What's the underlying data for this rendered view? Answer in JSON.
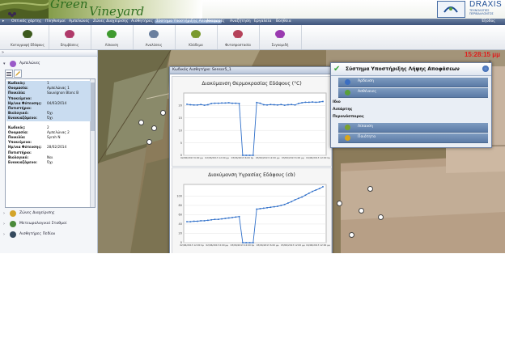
{
  "header": {
    "logo_line1": "Green",
    "logo_line2": "Vineyard",
    "company_name": "DRAXIS",
    "company_sub1": "ΤΕΧΝΟΛΟΓΙΕΣ",
    "company_sub2": "ΠΕΡΙΒΑΛΛΟΝΤΟΣ"
  },
  "menu": {
    "items": [
      "Οπτικός χάρτης",
      "Πληθυσμοί",
      "Αμπελώνες",
      "Ζώνες Διαχείρισης",
      "Αισθητήρες",
      "Σύστημα Υποστήριξης Αποφάσεων",
      "Αναφορές",
      "Αναζήτηση",
      "Εργαλεία",
      "Βοήθεια"
    ],
    "active_index": 5,
    "exit_label": "Έξοδος"
  },
  "toolbar": {
    "tools": [
      {
        "label": "Καταγραφή Εδάφους",
        "icon": "tractor-icon",
        "color": "#3d5a1e"
      },
      {
        "label": "Επιμβάσεις",
        "icon": "spray-icon",
        "color": "#b03a6a"
      },
      {
        "label": "Λίπανση",
        "icon": "leaf-icon",
        "color": "#3f9a2f"
      },
      {
        "label": "Αναλύσεις",
        "icon": "flask-icon",
        "color": "#6a7f9e"
      },
      {
        "label": "Κλάδεμα",
        "icon": "vine-icon",
        "color": "#7a9a2f"
      },
      {
        "label": "Φυτοπροστασία",
        "icon": "sprayer-person-icon",
        "color": "#b5425a"
      },
      {
        "label": "Συγκομιδή",
        "icon": "harvest-icon",
        "color": "#9a3ab0"
      }
    ]
  },
  "left_panel": {
    "collapse_glyph": "»",
    "tree_top": {
      "label": "Αμπελώνες",
      "icon_color": "#9a5ac8"
    },
    "records": [
      {
        "selected": true,
        "rows": [
          {
            "key": "Κωδικός:",
            "value": "1"
          },
          {
            "key": "Ονομασία:",
            "value": "Αμπελώνας 1"
          },
          {
            "key": "Ποικιλία:",
            "value": "Sauvignon Blanc B"
          },
          {
            "key": "Υποκείμενο:",
            "value": ""
          },
          {
            "key": "Ημ/νια Φύτευσης:",
            "value": "04/03/2014"
          },
          {
            "key": "Ποτιστήριο:",
            "value": ""
          },
          {
            "key": "Βιολογικό:",
            "value": "Όχι"
          },
          {
            "key": "Ενοικιαζόμενο:",
            "value": "Όχι"
          }
        ]
      },
      {
        "selected": false,
        "rows": [
          {
            "key": "Κωδικός:",
            "value": "2"
          },
          {
            "key": "Ονομασία:",
            "value": "Αμπελώνας 2"
          },
          {
            "key": "Ποικιλία:",
            "value": "Syrah N"
          },
          {
            "key": "Υποκείμενο:",
            "value": ""
          },
          {
            "key": "Ημ/νια Φύτευσης:",
            "value": "28/02/2014"
          },
          {
            "key": "Ποτιστήριο:",
            "value": ""
          },
          {
            "key": "Βιολογικό:",
            "value": "Ναι"
          },
          {
            "key": "Ενοικιαζόμενο:",
            "value": "Όχι"
          }
        ]
      }
    ],
    "tree_bottom": [
      {
        "label": "Ζώνες Διαχείρισης",
        "icon_color": "#d4a52a"
      },
      {
        "label": "Μετεωρολογικοί Σταθμοί",
        "icon_color": "#4a8a3a"
      },
      {
        "label": "Αισθητήρες Πεδίου",
        "icon_color": "#34495e"
      }
    ]
  },
  "map": {
    "time_label": "15:28:15 μμ"
  },
  "chart_window": {
    "title": "Κωδικός Αισθητήρα: Sensor5_1"
  },
  "chart_data": [
    {
      "type": "line",
      "title": "Διακύμανση Θερμοκρασίας Εδάφους (°C)",
      "xlabel": "",
      "ylabel": "",
      "ylim": [
        0,
        25
      ],
      "yticks": [
        0,
        5,
        10,
        15,
        20
      ],
      "xticks": [
        "02/06/2013 6:00 μμ",
        "02/06/2013 12:00 μμ",
        "03/06/2013 6:00 πμ",
        "03/06/2013 12:00 μμ",
        "03/06/2013 6:00 μμ",
        "04/06/2013 12:00 πμ"
      ],
      "x": [
        0,
        1,
        2,
        3,
        4,
        5,
        6,
        7,
        8,
        9,
        10,
        11,
        12,
        13,
        14,
        15,
        16,
        17,
        18,
        19,
        20,
        21,
        22,
        23,
        24,
        25,
        26,
        27,
        28,
        29,
        30,
        31,
        32,
        33,
        34,
        35,
        36,
        37,
        38,
        39
      ],
      "values": [
        20.5,
        20.3,
        20.2,
        20.2,
        20.4,
        20.1,
        20.3,
        20.8,
        20.9,
        20.9,
        21.0,
        21.0,
        21.1,
        20.9,
        20.9,
        20.8,
        0,
        0,
        0,
        0,
        21.2,
        20.9,
        20.3,
        20.2,
        20.4,
        20.3,
        20.2,
        20.4,
        20.1,
        20.3,
        20.4,
        20.2,
        20.8,
        21.1,
        21.3,
        21.3,
        21.4,
        21.3,
        21.4,
        21.6
      ]
    },
    {
      "type": "line",
      "title": "Διακύμανση Υγρασίας Εδάφους (cb)",
      "xlabel": "",
      "ylabel": "",
      "ylim": [
        0,
        125
      ],
      "yticks": [
        0,
        20,
        40,
        60,
        80,
        100
      ],
      "xticks": [
        "02/06/2013 12:00 πμ",
        "02/06/2013 6:00 μμ",
        "03/06/2013 12:00 πμ",
        "03/06/2013 6:00 μμ",
        "03/06/2013 12:00 μμ",
        "04/06/2013 12:00 μμ"
      ],
      "x": [
        0,
        1,
        2,
        3,
        4,
        5,
        6,
        7,
        8,
        9,
        10,
        11,
        12,
        13,
        14,
        15,
        16,
        17,
        18,
        19,
        20,
        21,
        22,
        23,
        24,
        25,
        26,
        27,
        28,
        29,
        30,
        31,
        32,
        33,
        34,
        35,
        36,
        37,
        38,
        39
      ],
      "values": [
        45,
        45,
        46,
        46,
        47,
        47,
        48,
        49,
        50,
        50,
        51,
        52,
        53,
        54,
        55,
        56,
        0,
        0,
        0,
        0,
        72,
        73,
        74,
        75,
        76,
        77,
        78,
        80,
        82,
        85,
        88,
        92,
        95,
        98,
        102,
        106,
        110,
        113,
        116,
        120
      ]
    }
  ],
  "dss": {
    "title": "Σύστημα Υποστήριξης Λήψης Αποφάσεων",
    "items_top": [
      {
        "label": "Άρδευση",
        "icon_color": "#3b6ec2"
      },
      {
        "label": "Ασθένειες",
        "icon_color": "#5aa03a"
      }
    ],
    "sections": [
      "Ιδιο",
      "Λιπάρτης",
      "Περονόσπορος"
    ],
    "items_bottom": [
      {
        "label": "Λίπανση",
        "icon_color": "#7aa12f"
      },
      {
        "label": "Ποιότητα",
        "icon_color": "#d9a51a"
      }
    ]
  }
}
